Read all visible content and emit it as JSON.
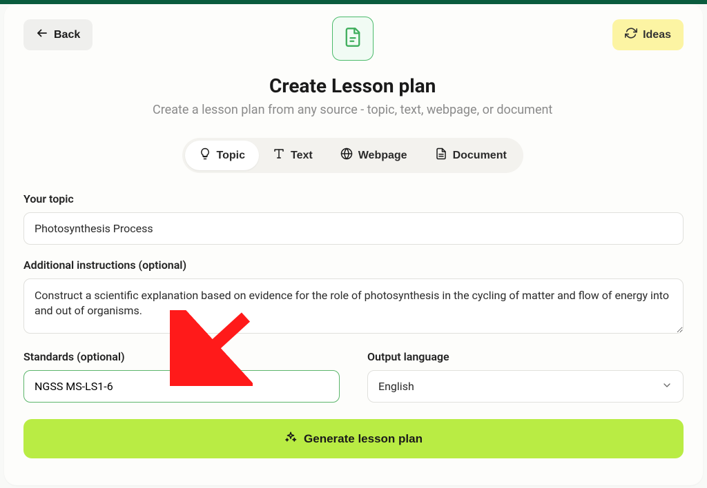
{
  "header": {
    "back_label": "Back",
    "ideas_label": "Ideas"
  },
  "page": {
    "title": "Create Lesson plan",
    "subtitle": "Create a lesson plan from any source - topic, text, webpage, or document"
  },
  "tabs": {
    "topic": "Topic",
    "text": "Text",
    "webpage": "Webpage",
    "document": "Document",
    "active": "topic"
  },
  "form": {
    "topic_label": "Your topic",
    "topic_value": "Photosynthesis Process",
    "instructions_label": "Additional instructions (optional)",
    "instructions_value": "Construct a scientific explanation based on evidence for the role of photosynthesis in the cycling of matter and flow of energy into and out of organisms.",
    "standards_label": "Standards (optional)",
    "standards_value": "NGSS MS-LS1-6",
    "language_label": "Output language",
    "language_value": "English"
  },
  "actions": {
    "generate_label": "Generate lesson plan"
  }
}
